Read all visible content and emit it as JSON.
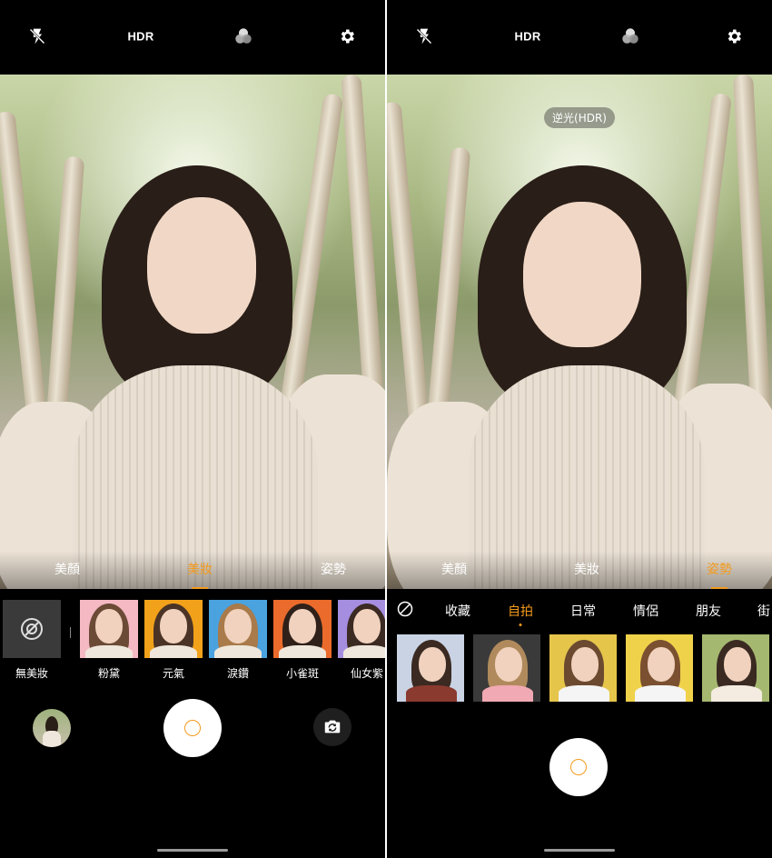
{
  "left": {
    "topbar": {
      "flash_icon": "flash-off-icon",
      "hdr_label": "HDR",
      "filter_icon": "color-filter-icon",
      "settings_icon": "gear-icon"
    },
    "mode_tabs": [
      {
        "label": "美顏",
        "active": false
      },
      {
        "label": "美妝",
        "active": true
      },
      {
        "label": "姿勢",
        "active": false
      }
    ],
    "makeup_items": [
      {
        "label": "無美妝",
        "bg": "#3a3a3a",
        "icon": "no-makeup-icon"
      },
      {
        "label": "粉黛",
        "bg": "#f4b9c3"
      },
      {
        "label": "元氣",
        "bg": "#f2a21a"
      },
      {
        "label": "淚鑽",
        "bg": "#4aa2df"
      },
      {
        "label": "小雀斑",
        "bg": "#ea6b2b"
      },
      {
        "label": "仙女紫",
        "bg": "#a58ee0"
      }
    ],
    "controls": {
      "gallery_icon": "gallery-thumbnail",
      "flip_icon": "camera-flip-icon"
    }
  },
  "right": {
    "topbar": {
      "flash_icon": "flash-off-icon",
      "hdr_label": "HDR",
      "filter_icon": "color-filter-icon",
      "settings_icon": "gear-icon"
    },
    "scene_badge": "逆光(HDR)",
    "mode_tabs": [
      {
        "label": "美顏",
        "active": false
      },
      {
        "label": "美妝",
        "active": false
      },
      {
        "label": "姿勢",
        "active": true
      }
    ],
    "pose_categories": [
      {
        "label": "收藏",
        "active": false
      },
      {
        "label": "自拍",
        "active": true
      },
      {
        "label": "日常",
        "active": false
      },
      {
        "label": "情侶",
        "active": false
      },
      {
        "label": "朋友",
        "active": false
      },
      {
        "label": "街",
        "active": false
      }
    ],
    "pose_thumbs": [
      {
        "bg": "#c9d3e4"
      },
      {
        "bg": "#3a3a3a"
      },
      {
        "bg": "#e6c64a"
      },
      {
        "bg": "#f0d24a"
      },
      {
        "bg": "#a5b870"
      }
    ]
  },
  "colors": {
    "accent": "#f39a1e",
    "background": "#000000"
  }
}
